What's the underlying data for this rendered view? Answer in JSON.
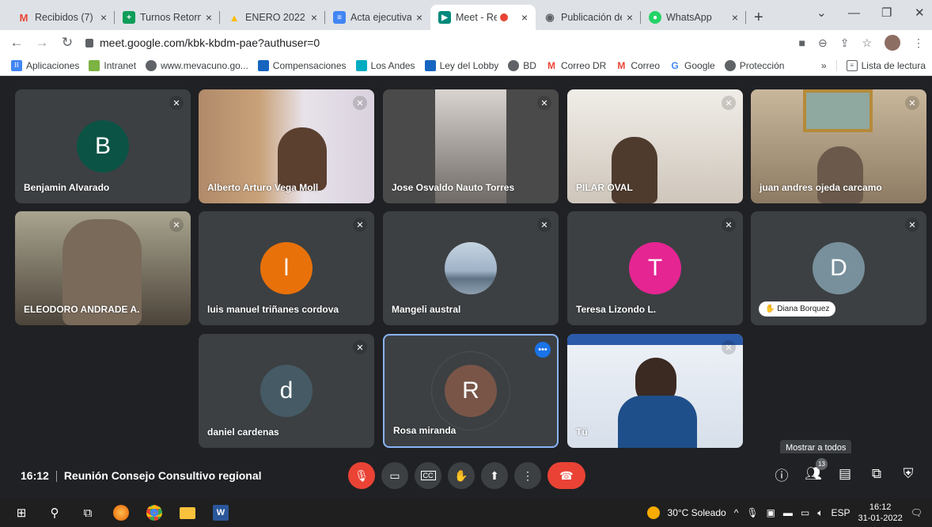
{
  "browser": {
    "tabs": [
      {
        "title": "Recibidos (7) -",
        "fav": "M",
        "color": "#ea4335"
      },
      {
        "title": "Turnos Retorno",
        "fav": "+",
        "color": "#0f9d58"
      },
      {
        "title": "ENERO 2022 -",
        "fav": "▲",
        "color": "#fbbc04"
      },
      {
        "title": "Acta ejecutiva",
        "fav": "≡",
        "color": "#4285f4"
      },
      {
        "title": "Meet - Rec",
        "fav": "▶",
        "color": "#00897b",
        "active": true
      },
      {
        "title": "Publicación del",
        "fav": "◉",
        "color": "#5f6368"
      },
      {
        "title": "WhatsApp",
        "fav": "●",
        "color": "#25d366"
      }
    ],
    "url": "meet.google.com/kbk-kbdm-pae?authuser=0",
    "bookmarks": [
      {
        "label": "Aplicaciones",
        "color": "#4285f4"
      },
      {
        "label": "Intranet",
        "color": "#7cb342"
      },
      {
        "label": "www.mevacuno.go...",
        "color": "#5f6368"
      },
      {
        "label": "Compensaciones",
        "color": "#1565c0"
      },
      {
        "label": "Los Andes",
        "color": "#00acc1"
      },
      {
        "label": "Ley del Lobby",
        "color": "#1565c0"
      },
      {
        "label": "BD",
        "color": "#5f6368"
      },
      {
        "label": "Correo DR",
        "color": "#ea4335"
      },
      {
        "label": "Correo",
        "color": "#ea4335"
      },
      {
        "label": "Google",
        "color": "#4285f4"
      },
      {
        "label": "Protección",
        "color": "#5f6368"
      }
    ],
    "more": "»",
    "reading_list": "Lista de lectura"
  },
  "participants": [
    {
      "name": "Benjamin Alvarado",
      "initial": "B",
      "color": "#0b5345",
      "type": "avatar"
    },
    {
      "name": "Alberto Arturo Vega Moll",
      "type": "video",
      "bg": "#c9a27a"
    },
    {
      "name": "Jose Osvaldo Nauto Torres",
      "type": "video",
      "bg": "#8d8a86"
    },
    {
      "name": "PILAR OVAL",
      "type": "video",
      "bg": "#d8d3cc"
    },
    {
      "name": "juan andres ojeda carcamo",
      "type": "video",
      "bg": "#b8a590"
    },
    {
      "name": "ELEODORO ANDRADE A.",
      "type": "video",
      "bg": "#6d6452"
    },
    {
      "name": "luis manuel triñanes cordova",
      "initial": "l",
      "color": "#e8710a",
      "type": "avatar"
    },
    {
      "name": "Mangeli austral",
      "type": "photo-avatar",
      "color": "#9fb3c8"
    },
    {
      "name": "Teresa Lizondo L.",
      "initial": "T",
      "color": "#e52592",
      "type": "avatar"
    },
    {
      "name": "Diana Borquez",
      "initial": "D",
      "color": "#78909c",
      "type": "avatar-pill"
    },
    {
      "name": "daniel cardenas",
      "initial": "d",
      "color": "#455a64",
      "type": "avatar"
    },
    {
      "name": "Rosa miranda",
      "initial": "R",
      "color": "#795548",
      "type": "avatar-active"
    },
    {
      "name": "Tú",
      "type": "video-self",
      "bg": "#e8eef6"
    }
  ],
  "meeting": {
    "time": "16:12",
    "title": "Reunión Consejo Consultivo regional"
  },
  "people_count": "13",
  "tooltip": "Mostrar a todos",
  "taskbar": {
    "weather": "30°C  Soleado",
    "lang": "ESP",
    "time": "16:12",
    "date": "31-01-2022"
  }
}
